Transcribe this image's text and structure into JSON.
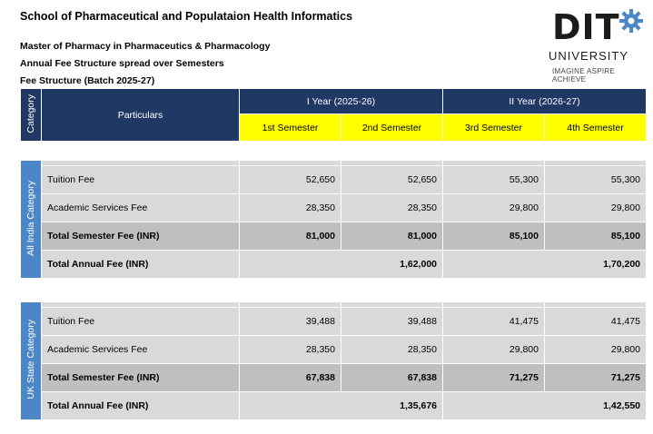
{
  "header": {
    "school": "School of Pharmaceutical and Populataion Health Informatics",
    "program": "Master of Pharmacy in Pharmaceutics & Pharmacology",
    "structure": "Annual Fee Structure spread over Semesters",
    "batch": "Fee Structure (Batch 2025-27)"
  },
  "logo": {
    "name": "DIT",
    "university": "UNIVERSITY",
    "tagline": "IMAGINE  ASPIRE  ACHIEVE"
  },
  "table": {
    "category_header": "Category",
    "particulars_header": "Particulars",
    "year1": "I Year (2025-26)",
    "year2": "II Year (2026-27)",
    "semesters": [
      "1st Semester",
      "2nd Semester",
      "3rd Semester",
      "4th Semester"
    ]
  },
  "sections": [
    {
      "category": "All India Category",
      "tuition": {
        "label": "Tuition Fee",
        "values": [
          "52,650",
          "52,650",
          "55,300",
          "55,300"
        ]
      },
      "academic": {
        "label": "Academic Services Fee",
        "values": [
          "28,350",
          "28,350",
          "29,800",
          "29,800"
        ]
      },
      "total": {
        "label": "Total Semester Fee (INR)",
        "values": [
          "81,000",
          "81,000",
          "85,100",
          "85,100"
        ]
      },
      "annual": {
        "label": "Total Annual Fee (INR)",
        "values": [
          "1,62,000",
          "1,70,200"
        ]
      }
    },
    {
      "category": "UK State Category",
      "tuition": {
        "label": "Tuition Fee",
        "values": [
          "39,488",
          "39,488",
          "41,475",
          "41,475"
        ]
      },
      "academic": {
        "label": "Academic Services Fee",
        "values": [
          "28,350",
          "28,350",
          "29,800",
          "29,800"
        ]
      },
      "total": {
        "label": "Total Semester Fee (INR)",
        "values": [
          "67,838",
          "67,838",
          "71,275",
          "71,275"
        ]
      },
      "annual": {
        "label": "Total Annual Fee (INR)",
        "values": [
          "1,35,676",
          "1,42,550"
        ]
      }
    }
  ]
}
